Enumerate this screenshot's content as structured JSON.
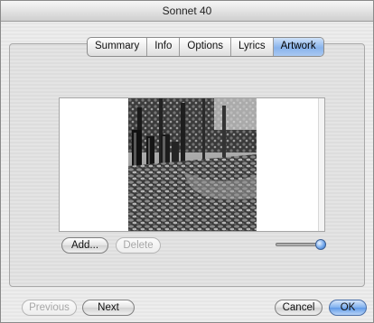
{
  "window": {
    "title": "Sonnet 40"
  },
  "tabs": [
    {
      "label": "Summary",
      "selected": false
    },
    {
      "label": "Info",
      "selected": false
    },
    {
      "label": "Options",
      "selected": false
    },
    {
      "label": "Lyrics",
      "selected": false
    },
    {
      "label": "Artwork",
      "selected": true
    }
  ],
  "artwork": {
    "add_label": "Add...",
    "delete_label": "Delete",
    "zoom_level": 1.0
  },
  "footer": {
    "previous_label": "Previous",
    "next_label": "Next",
    "cancel_label": "Cancel",
    "ok_label": "OK"
  },
  "colors": {
    "accent": "#6ea3ea",
    "tab_selected": "#9ec0f0"
  }
}
